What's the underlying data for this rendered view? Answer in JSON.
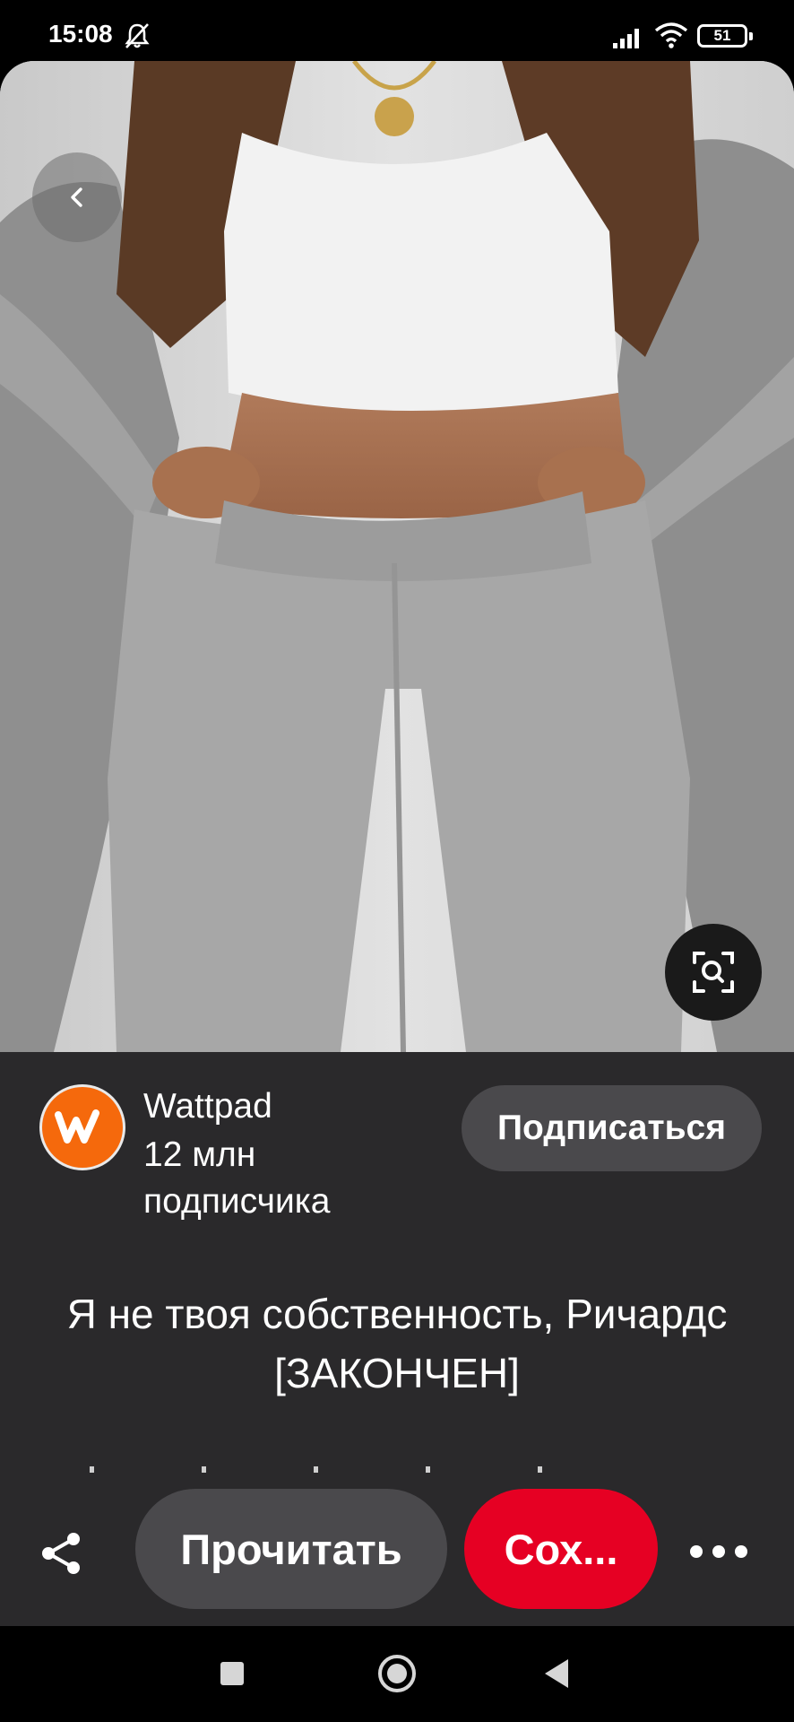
{
  "status_bar": {
    "time": "15:08",
    "battery": "51",
    "icons": [
      "mute-icon",
      "signal-icon",
      "wifi-icon",
      "battery-icon"
    ]
  },
  "image": {
    "buttons": [
      "back-icon",
      "visual-search-icon"
    ]
  },
  "creator": {
    "name": "Wattpad",
    "followers": "12 млн подписчика",
    "follow_label": "Подписаться",
    "avatar_icon": "wattpad-logo-icon",
    "avatar_color": "#f5690c"
  },
  "pin": {
    "title": "Я не твоя собственность, Ричардс [ЗАКОНЧЕН]"
  },
  "actions": {
    "share_icon": "share-icon",
    "read_label": "Прочитать",
    "save_label": "Сох...",
    "save_color": "#e60023",
    "more_icon": "more-horizontal-icon"
  },
  "nav_bar": {
    "icons": [
      "recents-icon",
      "home-icon",
      "back-icon"
    ]
  }
}
